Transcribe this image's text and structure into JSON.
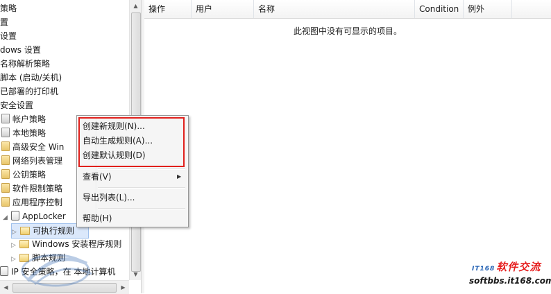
{
  "tree": {
    "items": [
      {
        "label": "策略",
        "icon": "none",
        "indent": 0
      },
      {
        "label": "置",
        "icon": "none",
        "indent": 0
      },
      {
        "label": "设置",
        "icon": "none",
        "indent": 0
      },
      {
        "label": "dows 设置",
        "icon": "none",
        "indent": 0
      },
      {
        "label": "名称解析策略",
        "icon": "none",
        "indent": 0
      },
      {
        "label": "脚本 (启动/关机)",
        "icon": "none",
        "indent": 0
      },
      {
        "label": "已部署的打印机",
        "icon": "none",
        "indent": 0
      },
      {
        "label": "安全设置",
        "icon": "none",
        "indent": 0
      },
      {
        "label": "帐户策略",
        "icon": "policy-icon",
        "indent": 1
      },
      {
        "label": "本地策略",
        "icon": "policy-icon",
        "indent": 1
      },
      {
        "label": "高级安全 Win",
        "icon": "policy-icon",
        "indent": 1
      },
      {
        "label": "网络列表管理",
        "icon": "policy-icon",
        "indent": 1
      },
      {
        "label": "公钥策略",
        "icon": "policy-icon",
        "indent": 1
      },
      {
        "label": "软件限制策略",
        "icon": "policy-icon",
        "indent": 1
      },
      {
        "label": "应用程序控制",
        "icon": "policy-icon",
        "indent": 1
      },
      {
        "label": "AppLocker",
        "icon": "applocker-icon",
        "indent": 2
      },
      {
        "label": "可执行规则",
        "icon": "folder-icon",
        "indent": 3
      },
      {
        "label": "Windows 安装程序规则",
        "icon": "installer-icon",
        "indent": 3
      },
      {
        "label": "脚本规则",
        "icon": "script-icon",
        "indent": 3
      },
      {
        "label": "IP 安全策略，在 本地计算机",
        "icon": "ipsec-icon",
        "indent": 0
      }
    ]
  },
  "list": {
    "columns": [
      "操作",
      "用户",
      "名称",
      "Condition",
      "例外"
    ],
    "empty_message": "此视图中没有可显示的项目。"
  },
  "context_menu": {
    "items": [
      {
        "label": "创建新规则(N)...",
        "submenu": false
      },
      {
        "label": "自动生成规则(A)...",
        "submenu": false
      },
      {
        "label": "创建默认规则(D)",
        "submenu": false
      },
      {
        "label": "查看(V)",
        "submenu": true
      },
      {
        "label": "导出列表(L)...",
        "submenu": false
      },
      {
        "label": "帮助(H)",
        "submenu": false
      }
    ],
    "highlight_color": "#e0201c"
  },
  "watermark": {
    "logo_prefix": "IT168",
    "logo_text": "软件交流",
    "url": "softbbs.it168.com"
  }
}
